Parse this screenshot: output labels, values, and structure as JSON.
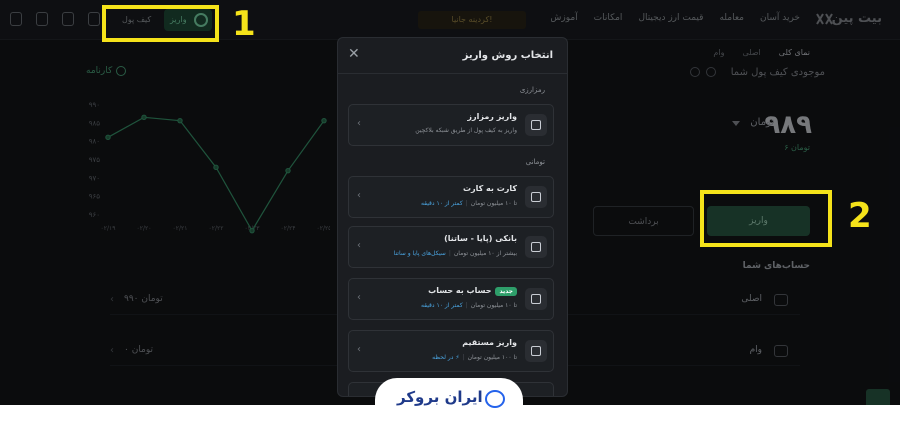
{
  "brand": {
    "logo": "بیت پین"
  },
  "nav": [
    "خرید آسان",
    "معامله",
    "قیمت ارز دیجیتال",
    "امکانات",
    "آموزش"
  ],
  "topbar": {
    "crypto_badge": "کردینه جانیا!",
    "wallet_label": "کیف پول",
    "deposit_label": "واریز"
  },
  "annotations": {
    "num1": "1",
    "num2": "2"
  },
  "panel": {
    "tabs": [
      "نمای کلی",
      "اصلی",
      "وام"
    ],
    "title": "موجودی کیف پول شما",
    "balance": "۹۸۹",
    "balance_unit": "تومان",
    "balance_sub": "۶ تومان",
    "deposit_button": "واریز",
    "withdraw_button": "برداشت",
    "accounts_title": "حساب‌های شما",
    "accounts": [
      {
        "name": "اصلی",
        "value": "۹۹۰ تومان"
      },
      {
        "name": "وام",
        "value": "۰ تومان"
      }
    ]
  },
  "chart_data": {
    "type": "line",
    "title": "کارنامه",
    "x": [
      "۰۲/۱۹",
      "۰۲/۲۰",
      "۰۲/۲۱",
      "۰۲/۲۲",
      "۰۲/۲۳",
      "۰۲/۲۴",
      "۰۲/۲۵"
    ],
    "values": [
      980,
      986,
      985,
      971,
      952,
      970,
      985
    ],
    "yticks": [
      "۹۹۰",
      "۹۸۵",
      "۹۸۰",
      "۹۷۵",
      "۹۷۰",
      "۹۶۵",
      "۹۶۰"
    ],
    "ylim": [
      957,
      990
    ],
    "line_color": "#3a9a6e"
  },
  "modal": {
    "title": "انتخاب روش واریز",
    "crypto_section": "رمزارزی",
    "toman_section": "تومانی",
    "options": [
      {
        "title": "واریز رمزارز",
        "desc": "واریز به کیف پول از طریق شبکه بلاکچین"
      },
      {
        "title": "کارت به کارت",
        "limit": "تا ۱۰ میلیون تومان",
        "time": "کمتر از ۱۰ دقیقه"
      },
      {
        "title": "بانکی (پایا - ساتنا)",
        "limit": "بیشتر از ۱۰ میلیون تومان",
        "time": "سیکل‌های پایا و ساتنا"
      },
      {
        "title": "حساب به حساب",
        "badge": "جدید",
        "limit": "تا ۱۰ میلیون تومان",
        "time": "کمتر از ۱۰ دقیقه"
      },
      {
        "title": "واریز مستقیم",
        "limit": "تا ۱۰۰ میلیون تومان",
        "time": "در لحظه"
      }
    ]
  },
  "footer": {
    "brand_text": "ایران بروکر"
  }
}
